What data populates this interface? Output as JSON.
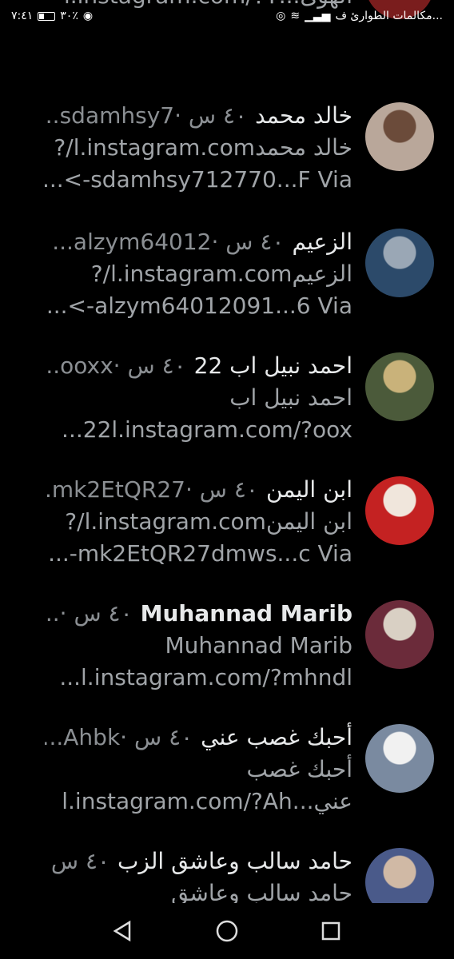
{
  "status": {
    "time": "٧:٤١",
    "battery": "٣٠٪",
    "battery_level": 0.3,
    "carrier": "مكالمات الطوارئ ف..."
  },
  "accounts": [
    {
      "name": "",
      "meta": "",
      "bio": [
        "الهوى...l.instagram.com/?Y"
      ],
      "avatar_colors": [
        "#7a1d1d",
        "#c9c9c9"
      ]
    },
    {
      "name": "خالد محمد",
      "meta": "٤٠ س ·sdamhsy7... @",
      "bio": [
        "خالد محمدl.instagram.com/?",
        "sdamhsy712770...F Via->..."
      ],
      "avatar_colors": [
        "#b9a79a",
        "#6b4b3a"
      ]
    },
    {
      "name": "الزعيم",
      "meta": "٤٠ س ·alzym64012... @",
      "bio": [
        "الزعيمl.instagram.com/?",
        "alzym64012091...6 Via->..."
      ],
      "avatar_colors": [
        "#2c4a6a",
        "#9aa7b5"
      ]
    },
    {
      "name": "احمد نبيل اب 22",
      "meta": "٤٠ س ·ooxx... @",
      "bio": [
        "احمد نبيل اب",
        "22l.instagram.com/?oox..."
      ],
      "avatar_colors": [
        "#4b5a3a",
        "#c9b27a"
      ]
    },
    {
      "name": "ابن اليمن",
      "meta": "٤٠ س ·mk2EtQR27... @",
      "bio": [
        "ابن اليمنl.instagram.com/?",
        "mk2EtQR27dmws...c Via-..."
      ],
      "avatar_colors": [
        "#c42222",
        "#f0e6dc"
      ]
    },
    {
      "name": "Muhannad Marib",
      "meta": "٤٠ س ·... @",
      "bio": [
        "Muhannad Marib",
        "l.instagram.com/?mhndl..."
      ],
      "avatar_colors": [
        "#6b2b3a",
        "#d9d0c4"
      ]
    },
    {
      "name": "أحبك غصب عني",
      "meta": "٤٠ س ·Ahbk... @",
      "bio": [
        "أحبك غصب",
        "عني...l.instagram.com/?Ah"
      ],
      "avatar_colors": [
        "#7a8aa0",
        "#f1f1f1"
      ]
    },
    {
      "name": "حامد سالب وعاشق الزب",
      "meta": "٤٠ س ·...",
      "bio": [
        "حامد سالب وعاشق"
      ],
      "avatar_colors": [
        "#4a5a8a",
        "#d0b9a5"
      ]
    }
  ],
  "nav": {
    "back": "◁",
    "home": "○",
    "recents": "□"
  }
}
